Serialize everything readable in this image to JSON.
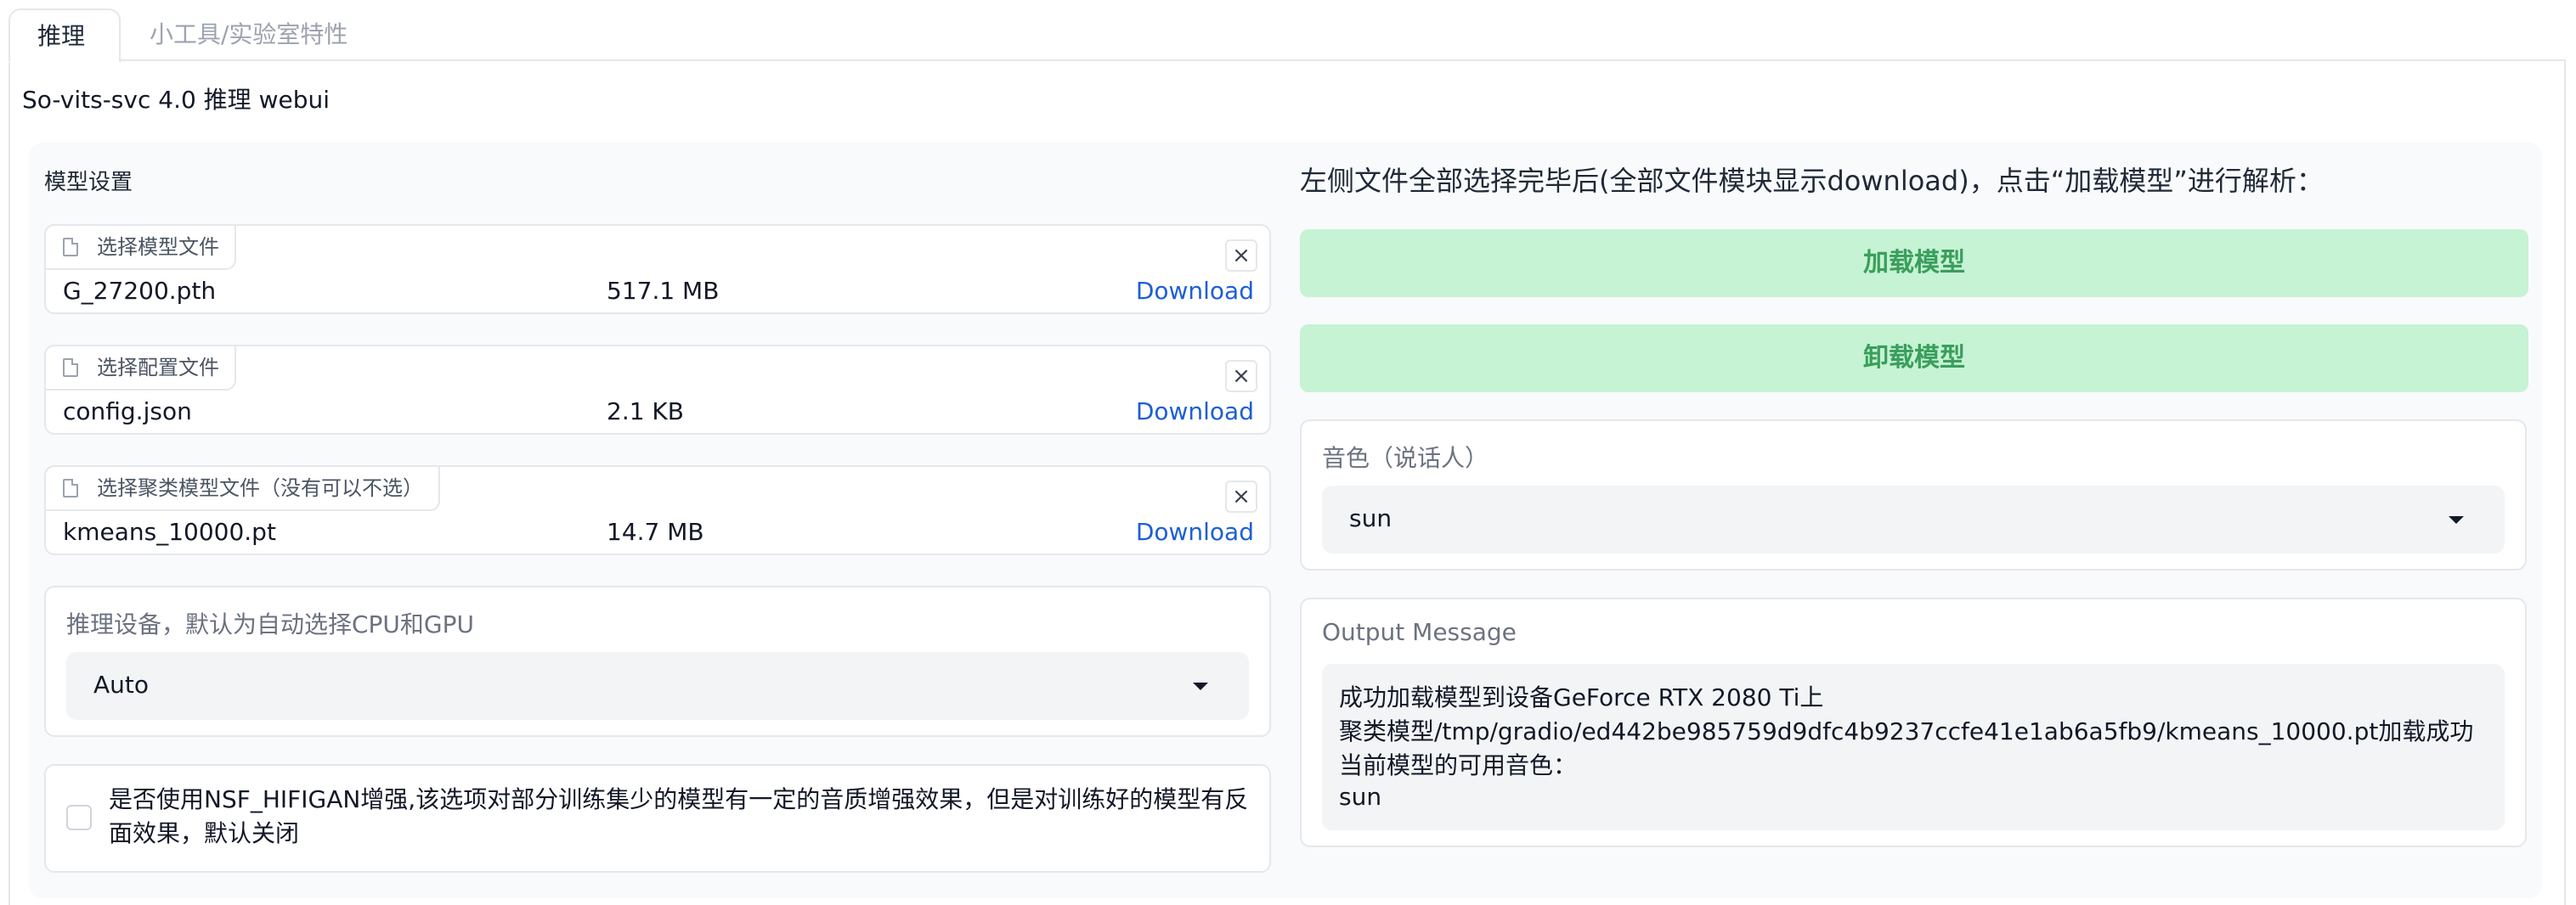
{
  "tabs": [
    {
      "label": "推理",
      "active": true
    },
    {
      "label": "小工具/实验室特性",
      "active": false
    }
  ],
  "app_title": "So-vits-svc 4.0 推理 webui",
  "model_settings": {
    "section_label": "模型设置",
    "files": [
      {
        "label": "选择模型文件",
        "name": "G_27200.pth",
        "size": "517.1 MB",
        "download": "Download"
      },
      {
        "label": "选择配置文件",
        "name": "config.json",
        "size": "2.1 KB",
        "download": "Download"
      },
      {
        "label": "选择聚类模型文件（没有可以不选）",
        "name": "kmeans_10000.pt",
        "size": "14.7 MB",
        "download": "Download"
      }
    ],
    "device": {
      "label": "推理设备，默认为自动选择CPU和GPU",
      "value": "Auto"
    },
    "nsf_hifigan": {
      "text": "是否使用NSF_HIFIGAN增强,该选项对部分训练集少的模型有一定的音质增强效果，但是对训练好的模型有反面效果，默认关闭",
      "checked": false
    }
  },
  "right_panel": {
    "hint": "左侧文件全部选择完毕后(全部文件模块显示download)，点击“加载模型”进行解析：",
    "load_button": "加载模型",
    "unload_button": "卸载模型",
    "speaker": {
      "label": "音色（说话人）",
      "value": "sun"
    },
    "output": {
      "label": "Output Message",
      "lines": [
        "成功加载模型到设备GeForce RTX 2080 Ti上",
        "聚类模型/tmp/gradio/ed442be985759d9dfc4b9237ccfe41e1ab6a5fb9/kmeans_10000.pt加载成功",
        "当前模型的可用音色：",
        "sun"
      ]
    }
  },
  "colors": {
    "accent_button_bg": "#c6f3d4",
    "accent_button_text": "#3a9e5c",
    "link": "#1d5fd6"
  }
}
